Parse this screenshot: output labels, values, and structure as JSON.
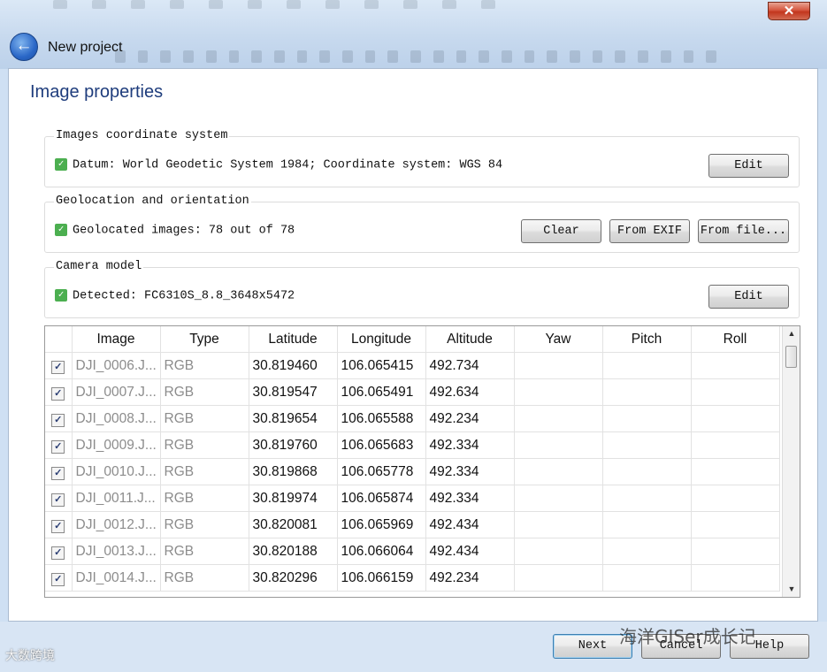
{
  "window": {
    "title": "New project",
    "close_glyph": "✕",
    "back_glyph": "←"
  },
  "page": {
    "heading": "Image properties"
  },
  "coordinate_system": {
    "title": "Images coordinate system",
    "status": "Datum: World Geodetic System 1984; Coordinate system: WGS 84",
    "edit_label": "Edit"
  },
  "geolocation": {
    "title": "Geolocation and orientation",
    "status": "Geolocated images: 78 out of 78",
    "clear_label": "Clear",
    "from_exif_label": "From EXIF",
    "from_file_label": "From file..."
  },
  "camera": {
    "title": "Camera model",
    "status": "Detected: FC6310S_8.8_3648x5472",
    "edit_label": "Edit"
  },
  "table": {
    "headers": {
      "image": "Image",
      "type": "Type",
      "latitude": "Latitude",
      "longitude": "Longitude",
      "altitude": "Altitude",
      "yaw": "Yaw",
      "pitch": "Pitch",
      "roll": "Roll"
    },
    "rows": [
      {
        "image": "DJI_0006.J...",
        "type": "RGB",
        "latitude": "30.819460",
        "longitude": "106.065415",
        "altitude": "492.734",
        "yaw": "",
        "pitch": "",
        "roll": ""
      },
      {
        "image": "DJI_0007.J...",
        "type": "RGB",
        "latitude": "30.819547",
        "longitude": "106.065491",
        "altitude": "492.634",
        "yaw": "",
        "pitch": "",
        "roll": ""
      },
      {
        "image": "DJI_0008.J...",
        "type": "RGB",
        "latitude": "30.819654",
        "longitude": "106.065588",
        "altitude": "492.234",
        "yaw": "",
        "pitch": "",
        "roll": ""
      },
      {
        "image": "DJI_0009.J...",
        "type": "RGB",
        "latitude": "30.819760",
        "longitude": "106.065683",
        "altitude": "492.334",
        "yaw": "",
        "pitch": "",
        "roll": ""
      },
      {
        "image": "DJI_0010.J...",
        "type": "RGB",
        "latitude": "30.819868",
        "longitude": "106.065778",
        "altitude": "492.334",
        "yaw": "",
        "pitch": "",
        "roll": ""
      },
      {
        "image": "DJI_0011.J...",
        "type": "RGB",
        "latitude": "30.819974",
        "longitude": "106.065874",
        "altitude": "492.334",
        "yaw": "",
        "pitch": "",
        "roll": ""
      },
      {
        "image": "DJI_0012.J...",
        "type": "RGB",
        "latitude": "30.820081",
        "longitude": "106.065969",
        "altitude": "492.434",
        "yaw": "",
        "pitch": "",
        "roll": ""
      },
      {
        "image": "DJI_0013.J...",
        "type": "RGB",
        "latitude": "30.820188",
        "longitude": "106.066064",
        "altitude": "492.434",
        "yaw": "",
        "pitch": "",
        "roll": ""
      },
      {
        "image": "DJI_0014.J...",
        "type": "RGB",
        "latitude": "30.820296",
        "longitude": "106.066159",
        "altitude": "492.234",
        "yaw": "",
        "pitch": "",
        "roll": ""
      }
    ]
  },
  "footer": {
    "next_label": "Next",
    "cancel_label": "Cancel",
    "help_label": "Help"
  },
  "watermark": {
    "right": "海洋GISer成长记",
    "left": "大数跨境"
  },
  "colors": {
    "heading": "#1e3c7c",
    "check_green": "#4caf50",
    "close_red": "#c2361d"
  }
}
